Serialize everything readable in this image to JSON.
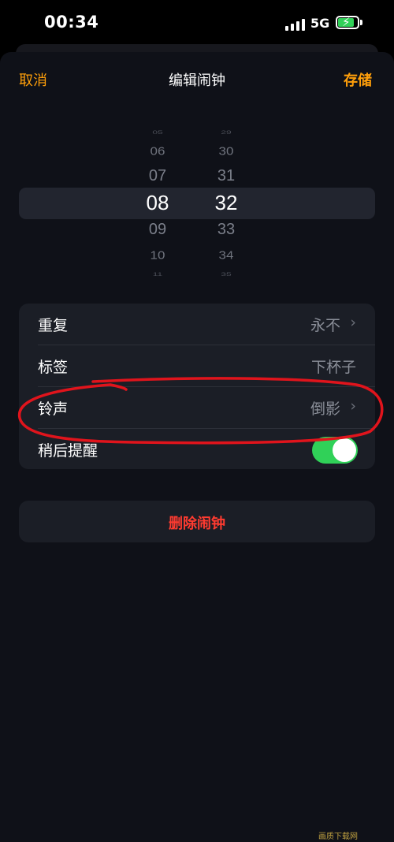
{
  "status_bar": {
    "time": "00:34",
    "network": "5G",
    "battery_level": 0.85,
    "battery_color": "#30d158"
  },
  "nav": {
    "cancel_label": "取消",
    "title": "编辑闹钟",
    "save_label": "存储",
    "accent_color": "#ff9f0a"
  },
  "picker": {
    "hours": [
      "05",
      "06",
      "07",
      "08",
      "09",
      "10",
      "11"
    ],
    "minutes": [
      "29",
      "30",
      "31",
      "32",
      "33",
      "34",
      "35"
    ],
    "selected_hour": "08",
    "selected_minute": "32"
  },
  "settings": {
    "repeat": {
      "label": "重复",
      "value": "永不",
      "icon": "chevron-right-icon"
    },
    "label": {
      "label": "标签",
      "value": "下杯子"
    },
    "sound": {
      "label": "铃声",
      "value": "倒影",
      "icon": "chevron-right-icon"
    },
    "snooze": {
      "label": "稍后提醒",
      "enabled": true,
      "color": "#30d158"
    }
  },
  "delete": {
    "label": "删除闹钟",
    "color": "#ff3b30"
  },
  "annotation": {
    "shape": "hand-drawn ellipse",
    "color": "#e0141c",
    "target": "sound row"
  },
  "watermark": "画质下载网"
}
